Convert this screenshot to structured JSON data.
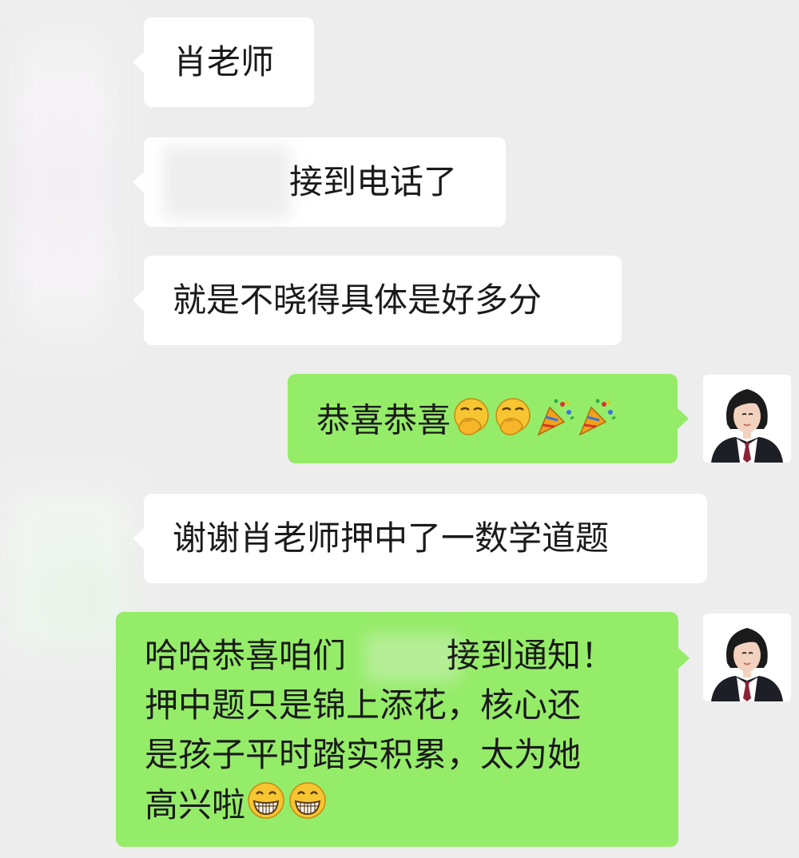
{
  "messages": {
    "m1": "肖老师",
    "m2": "接到电话了",
    "m3": "就是不晓得具体是好多分",
    "m4": "恭喜恭喜",
    "m5": "谢谢肖老师押中了一数学道题",
    "m6_line1_pre": "哈哈恭喜咱们",
    "m6_line1_post": "接到通知！",
    "m6_line2": "押中题只是锦上添花，核心还",
    "m6_line3": "是孩子平时踏实积累，太为她",
    "m6_line4": "高兴啦"
  },
  "icons": {
    "m4_emojis": [
      "hand-over-mouth-emoji",
      "hand-over-mouth-emoji",
      "party-popper-emoji",
      "party-popper-emoji"
    ],
    "m6_emojis": [
      "grinning-face-emoji",
      "grinning-face-emoji"
    ],
    "avatar": "teacher-avatar"
  },
  "colors": {
    "background": "#ededed",
    "incoming_bubble": "#ffffff",
    "outgoing_bubble": "#95ec69",
    "text": "#1a1a1a"
  }
}
